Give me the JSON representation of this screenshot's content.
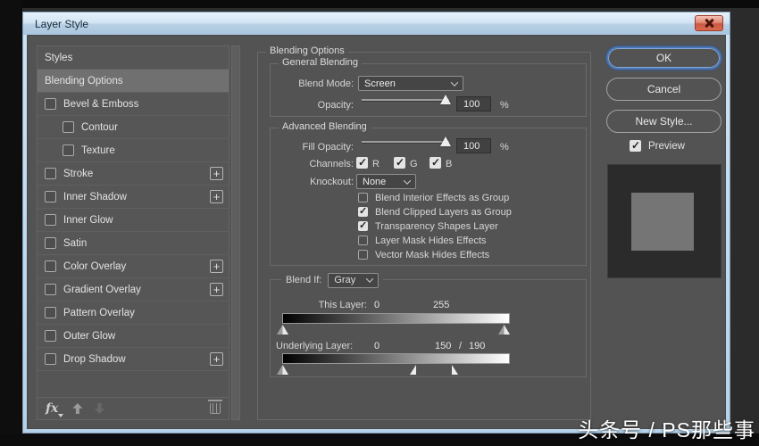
{
  "window": {
    "title": "Layer Style"
  },
  "watermark": "头条号 / PS那些事",
  "sidebar": {
    "items": [
      {
        "label": "Styles",
        "checkbox": false,
        "selected": false
      },
      {
        "label": "Blending Options",
        "checkbox": false,
        "selected": true
      },
      {
        "label": "Bevel & Emboss",
        "checkbox": true,
        "checked": false
      },
      {
        "label": "Contour",
        "checkbox": true,
        "checked": false,
        "indent": true
      },
      {
        "label": "Texture",
        "checkbox": true,
        "checked": false,
        "indent": true
      },
      {
        "label": "Stroke",
        "checkbox": true,
        "checked": false,
        "plus": true
      },
      {
        "label": "Inner Shadow",
        "checkbox": true,
        "checked": false,
        "plus": true
      },
      {
        "label": "Inner Glow",
        "checkbox": true,
        "checked": false
      },
      {
        "label": "Satin",
        "checkbox": true,
        "checked": false
      },
      {
        "label": "Color Overlay",
        "checkbox": true,
        "checked": false,
        "plus": true
      },
      {
        "label": "Gradient Overlay",
        "checkbox": true,
        "checked": false,
        "plus": true
      },
      {
        "label": "Pattern Overlay",
        "checkbox": true,
        "checked": false
      },
      {
        "label": "Outer Glow",
        "checkbox": true,
        "checked": false
      },
      {
        "label": "Drop Shadow",
        "checkbox": true,
        "checked": false,
        "plus": true
      }
    ],
    "footer": {
      "fx_label": "fx"
    }
  },
  "main": {
    "title": "Blending Options",
    "general": {
      "title": "General Blending",
      "blend_mode_label": "Blend Mode:",
      "blend_mode_value": "Screen",
      "opacity_label": "Opacity:",
      "opacity_value": "100",
      "opacity_unit": "%"
    },
    "advanced": {
      "title": "Advanced Blending",
      "fill_opacity_label": "Fill Opacity:",
      "fill_opacity_value": "100",
      "fill_opacity_unit": "%",
      "channels_label": "Channels:",
      "channels": [
        {
          "label": "R",
          "checked": true
        },
        {
          "label": "G",
          "checked": true
        },
        {
          "label": "B",
          "checked": true
        }
      ],
      "knockout_label": "Knockout:",
      "knockout_value": "None",
      "options": [
        {
          "label": "Blend Interior Effects as Group",
          "checked": false
        },
        {
          "label": "Blend Clipped Layers as Group",
          "checked": true
        },
        {
          "label": "Transparency Shapes Layer",
          "checked": true
        },
        {
          "label": "Layer Mask Hides Effects",
          "checked": false
        },
        {
          "label": "Vector Mask Hides Effects",
          "checked": false
        }
      ]
    },
    "blend_if": {
      "label": "Blend If:",
      "value": "Gray",
      "this_layer_label": "This Layer:",
      "this_layer_min": "0",
      "this_layer_max": "255",
      "underlying_label": "Underlying Layer:",
      "underlying_min": "0",
      "underlying_split_low": "150",
      "underlying_split_sep": "/",
      "underlying_split_high": "190"
    }
  },
  "actions": {
    "ok": "OK",
    "cancel": "Cancel",
    "new_style": "New Style...",
    "preview_label": "Preview",
    "preview_checked": true
  },
  "colors": {
    "dialog_bg": "#535353",
    "frame_blue": "#bdd8ee",
    "selected_item": "#707070",
    "accent_focus_blue": "#4a76b8",
    "close_button_red": "#cd5944",
    "thumbnail_bg": "#2b2b2b",
    "thumbnail_square": "#757575"
  }
}
